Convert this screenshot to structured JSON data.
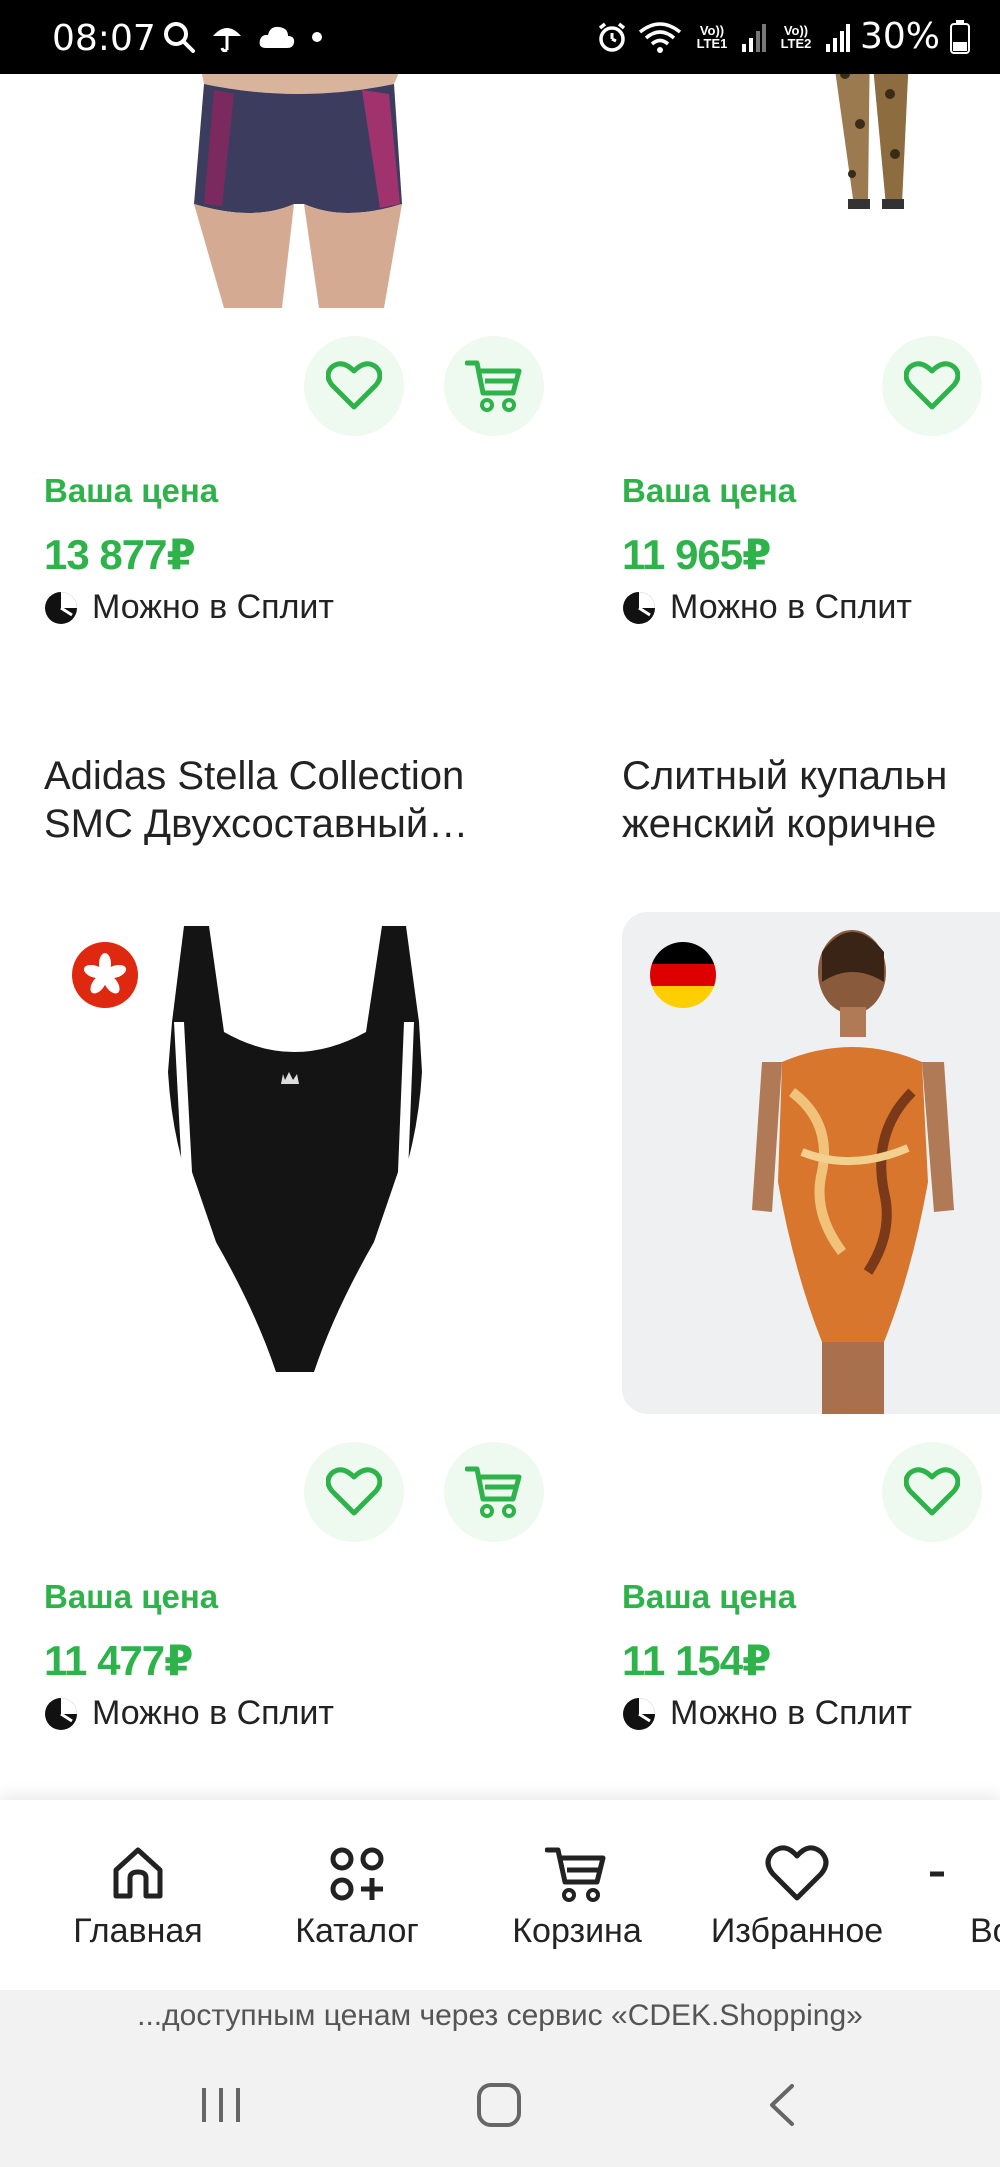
{
  "status_bar": {
    "time": "08:07",
    "battery": "30%",
    "sim1": "Vo)) LTE1",
    "sim2": "Vo)) LTE2"
  },
  "products": [
    {
      "price_label": "Ваша цена",
      "price": "13 877₽",
      "split_text": "Можно в Сплит",
      "title_line1": "Adidas Stella Collection",
      "title_line2": "SMC Двухсоставный…"
    },
    {
      "price_label": "Ваша цена",
      "price": "11 965₽",
      "split_text": "Можно в Сплит",
      "title_line1": "Слитный купальн",
      "title_line2": "женский коричне"
    },
    {
      "price_label": "Ваша цена",
      "price": "11 477₽",
      "split_text": "Можно в Сплит",
      "origin_flag": "hong-kong-flag"
    },
    {
      "price_label": "Ваша цена",
      "price": "11 154₽",
      "split_text": "Можно в Сплит",
      "origin_flag": "germany-flag"
    }
  ],
  "bottom_nav": {
    "items": [
      {
        "label": "Главная",
        "icon": "home-icon"
      },
      {
        "label": "Каталог",
        "icon": "catalog-icon"
      },
      {
        "label": "Корзина",
        "icon": "cart-icon"
      },
      {
        "label": "Избранное",
        "icon": "heart-icon"
      },
      {
        "label": "Во",
        "icon": "more-icon"
      }
    ]
  },
  "footer_banner": "...доступным ценам через сервис «CDEK.Shopping»",
  "colors": {
    "accent_green": "#2db34a",
    "icon_bg": "#eefaf0"
  }
}
